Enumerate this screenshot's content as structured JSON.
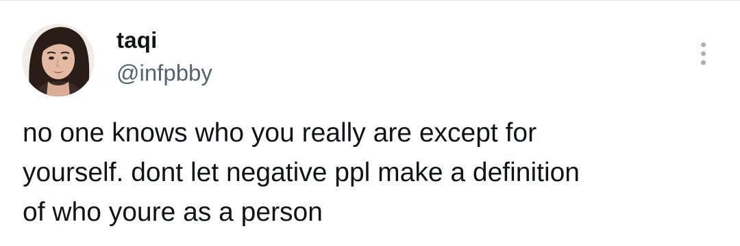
{
  "author": {
    "display_name": "taqi",
    "handle": "@infpbby",
    "avatar_icon": "profile-photo"
  },
  "more_icon": "vertical-ellipsis-icon",
  "tweet": {
    "text_lines": [
      "no one knows who you really are except for",
      "yourself. dont let negative ppl make a definition",
      "of who youre as a person"
    ]
  },
  "colors": {
    "text": "#0f1419",
    "secondary": "#536471",
    "dots": "#a9b2bb"
  }
}
